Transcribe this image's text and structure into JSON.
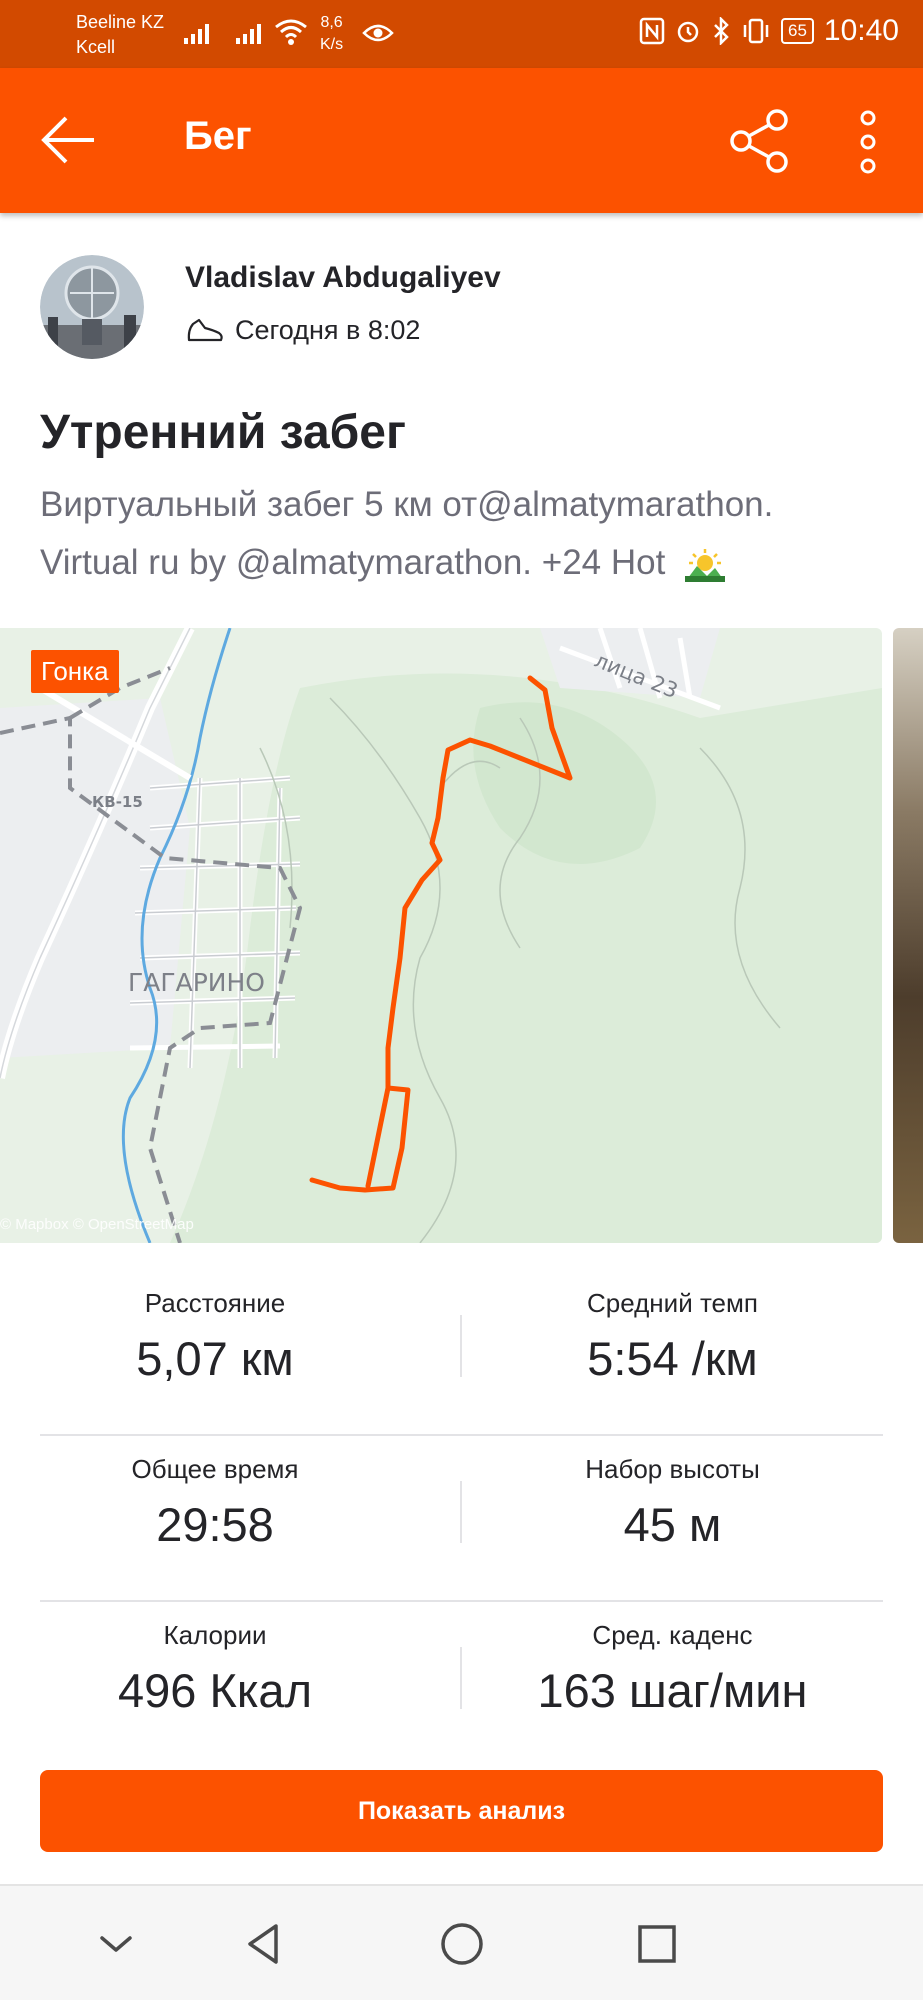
{
  "status_bar": {
    "carrier_1": "Beeline KZ",
    "carrier_2": "Kcell",
    "net_speed_value": "8,6",
    "net_speed_unit": "K/s",
    "battery": "65",
    "time": "10:40"
  },
  "app_bar": {
    "title": "Бег",
    "back_icon": "arrow-left-icon",
    "share_icon": "share-icon",
    "more_icon": "more-vertical-icon"
  },
  "athlete": {
    "name": "Vladislav Abdugaliyev",
    "timestamp": "Сегодня в 8:02",
    "activity_icon": "running-shoe-icon"
  },
  "activity": {
    "title": "Утренний забег",
    "description_line1": "Виртуальный забег 5 км от@almatymarathon.",
    "description_line2": "Virtual ru by @almatymarathon. +24  Hot"
  },
  "map": {
    "badge": "Гонка",
    "place_label": "ГАГАРИНО",
    "road_label_1": "КВ-15",
    "street_label": "лица 23",
    "credit": "© Mapbox © OpenStreetMap",
    "route_color": "#fc5200"
  },
  "stats": [
    {
      "left_label": "Расстояние",
      "left_value": "5,07 км",
      "right_label": "Средний темп",
      "right_value": "5:54 /км"
    },
    {
      "left_label": "Общее время",
      "left_value": "29:58",
      "right_label": "Набор высоты",
      "right_value": "45 м"
    },
    {
      "left_label": "Калории",
      "left_value": "496 Ккал",
      "right_label": "Сред. каденс",
      "right_value": "163 шаг/мин"
    }
  ],
  "analysis_button": "Показать анализ",
  "colors": {
    "brand": "#fc5200",
    "status_bar": "#d24a00",
    "text_primary": "#242428",
    "text_secondary": "#6d6d78"
  }
}
